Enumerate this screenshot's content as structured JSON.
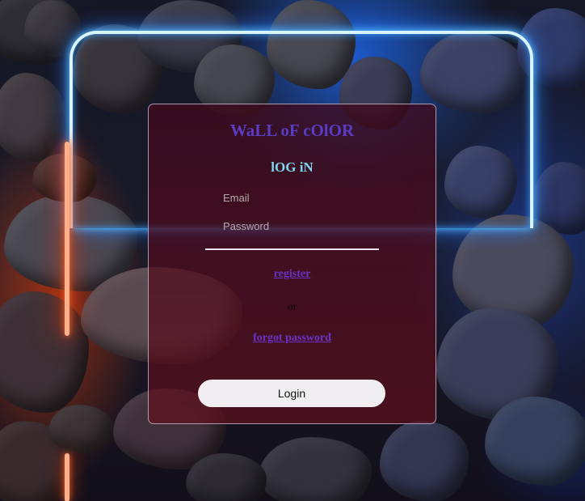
{
  "brand": {
    "title": "WaLL oF cOlOR"
  },
  "form": {
    "heading": "lOG iN",
    "email_placeholder": "Email",
    "password_placeholder": "Password",
    "register_label": "register",
    "or_label": "or",
    "forgot_label": "forgot password",
    "login_label": "Login"
  },
  "colors": {
    "title": "#5a3cc4",
    "heading": "#7fd6f0",
    "link": "#6a32c8",
    "neon_red": "#ff4a10",
    "neon_blue": "#2a7dff"
  }
}
